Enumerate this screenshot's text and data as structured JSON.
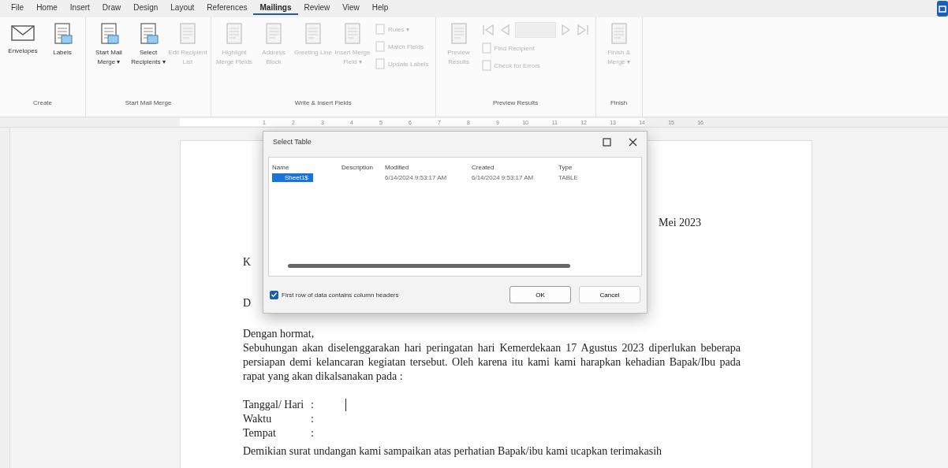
{
  "menu_tabs": [
    {
      "label": "File",
      "selected": false
    },
    {
      "label": "Home",
      "selected": false
    },
    {
      "label": "Insert",
      "selected": false
    },
    {
      "label": "Draw",
      "selected": false
    },
    {
      "label": "Design",
      "selected": false
    },
    {
      "label": "Layout",
      "selected": false
    },
    {
      "label": "References",
      "selected": false
    },
    {
      "label": "Mailings",
      "selected": true
    },
    {
      "label": "Review",
      "selected": false
    },
    {
      "label": "View",
      "selected": false
    },
    {
      "label": "Help",
      "selected": false
    }
  ],
  "ribbon": [
    {
      "name": "Create",
      "items": [
        {
          "kind": "large",
          "label": "Envelopes",
          "disabled": false
        },
        {
          "kind": "large",
          "label": "Labels",
          "disabled": false
        }
      ]
    },
    {
      "name": "Start Mail Merge",
      "items": [
        {
          "kind": "large",
          "label": "Start Mail Merge ▾",
          "disabled": false
        },
        {
          "kind": "large",
          "label": "Select Recipients ▾",
          "disabled": false
        },
        {
          "kind": "large",
          "label": "Edit Recipient List",
          "disabled": true
        }
      ]
    },
    {
      "name": "Write & Insert Fields",
      "items": [
        {
          "kind": "large",
          "label": "Highlight Merge Fields",
          "disabled": true
        },
        {
          "kind": "large",
          "label": "Address Block",
          "disabled": true
        },
        {
          "kind": "large",
          "label": "Greeting Line",
          "disabled": true
        },
        {
          "kind": "large",
          "label": "Insert Merge Field ▾",
          "disabled": true
        },
        {
          "kind": "small",
          "label": "Rules ▾",
          "disabled": true
        },
        {
          "kind": "small",
          "label": "Match Fields",
          "disabled": true
        },
        {
          "kind": "small",
          "label": "Update Labels",
          "disabled": true
        }
      ]
    },
    {
      "name": "Preview Results",
      "items": [
        {
          "kind": "large",
          "label": "Preview Results",
          "disabled": true
        },
        {
          "kind": "nav",
          "disabled": true
        },
        {
          "kind": "small",
          "label": "Find Recipient",
          "disabled": true
        },
        {
          "kind": "small",
          "label": "Check for Errors",
          "disabled": true
        }
      ]
    },
    {
      "name": "Finish",
      "items": [
        {
          "kind": "large",
          "label": "Finish & Merge ▾",
          "disabled": true
        }
      ]
    }
  ],
  "ruler": [
    "1",
    "2",
    "3",
    "4",
    "5",
    "6",
    "7",
    "8",
    "9",
    "10",
    "11",
    "12",
    "13",
    "14",
    "15",
    "16"
  ],
  "document": {
    "date": "Mei 2023",
    "line_1": "K",
    "line_2": "D",
    "greeting": "Dengan hormat,",
    "paragraph": "Sebuhungan akan diselenggarakan hari peringatan hari Kemerdekaan 17 Agustus 2023 diperlukan beberapa persiapan demi kelancaran kegiatan tersebut. Oleh karena itu kami kami harapkan kehadian Bapak/Ibu pada rapat yang akan dikalsanakan pada :",
    "fields": [
      {
        "label": "Tanggal/ Hari",
        "sep": ":"
      },
      {
        "label": "Waktu",
        "sep": ":"
      },
      {
        "label": "Tempat",
        "sep": ":"
      }
    ],
    "closing": "Demikian surat undangan kami sampaikan atas perhatian Bapak/ibu kami ucapkan terimakasih"
  },
  "dialog": {
    "title": "Select Table",
    "columns": [
      "Name",
      "Description",
      "Modified",
      "Created",
      "Type"
    ],
    "rows": [
      {
        "cells": [
          "Sheet1$",
          "",
          "6/14/2024 9:53:17 AM",
          "6/14/2024 9:53:17 AM",
          "TABLE"
        ],
        "selected": true
      }
    ],
    "checkbox": {
      "label": "First row of data contains column headers",
      "checked": true
    },
    "buttons": [
      "OK",
      "Cancel"
    ]
  }
}
